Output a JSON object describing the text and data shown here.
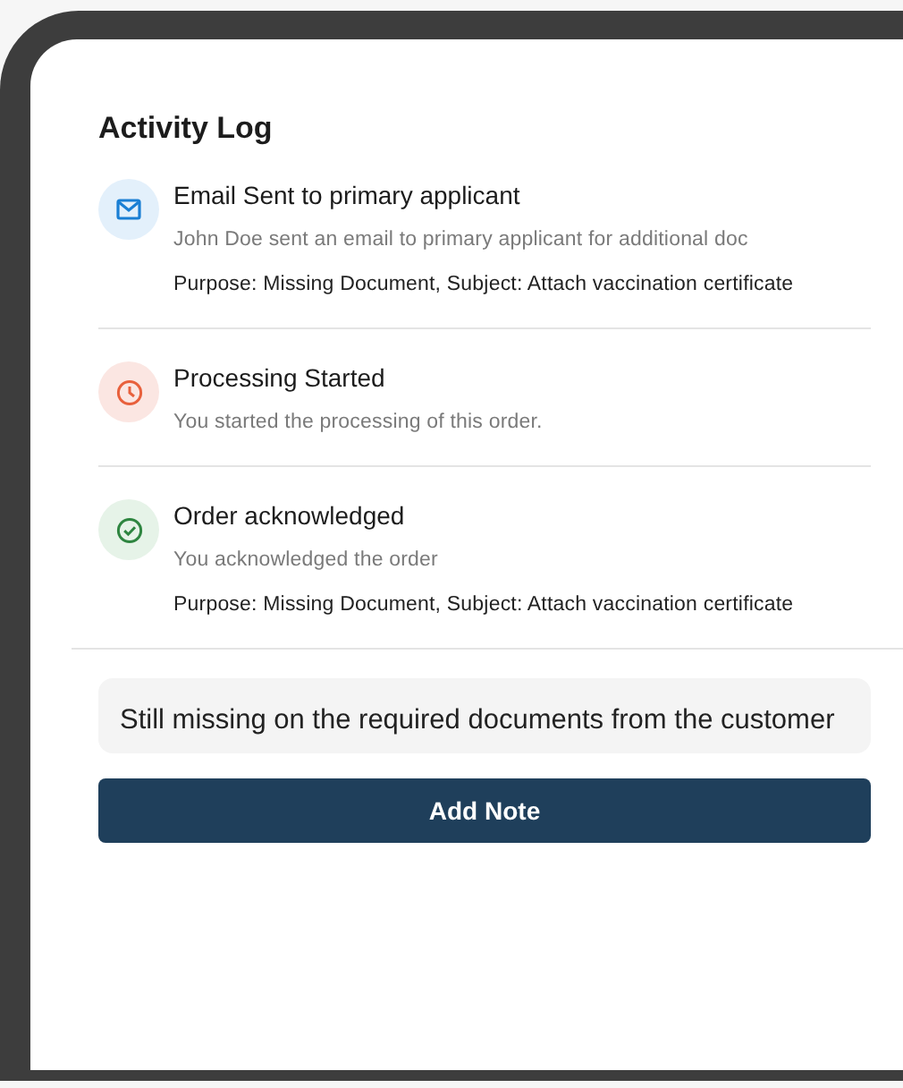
{
  "title": "Activity Log",
  "activities": [
    {
      "kind": "email",
      "title": "Email Sent to primary applicant",
      "description": "John Doe sent an email to primary applicant for additional doc",
      "details": "Purpose: Missing Document, Subject: Attach vaccination certificate"
    },
    {
      "kind": "clock",
      "title": "Processing Started",
      "description": "You started the processing of this order."
    },
    {
      "kind": "check",
      "title": "Order acknowledged",
      "description": "You acknowledged the order",
      "details": "Purpose: Missing Document, Subject: Attach vaccination certificate"
    }
  ],
  "note": {
    "value": "Still missing on the required documents from the customer"
  },
  "button": "Add Note"
}
